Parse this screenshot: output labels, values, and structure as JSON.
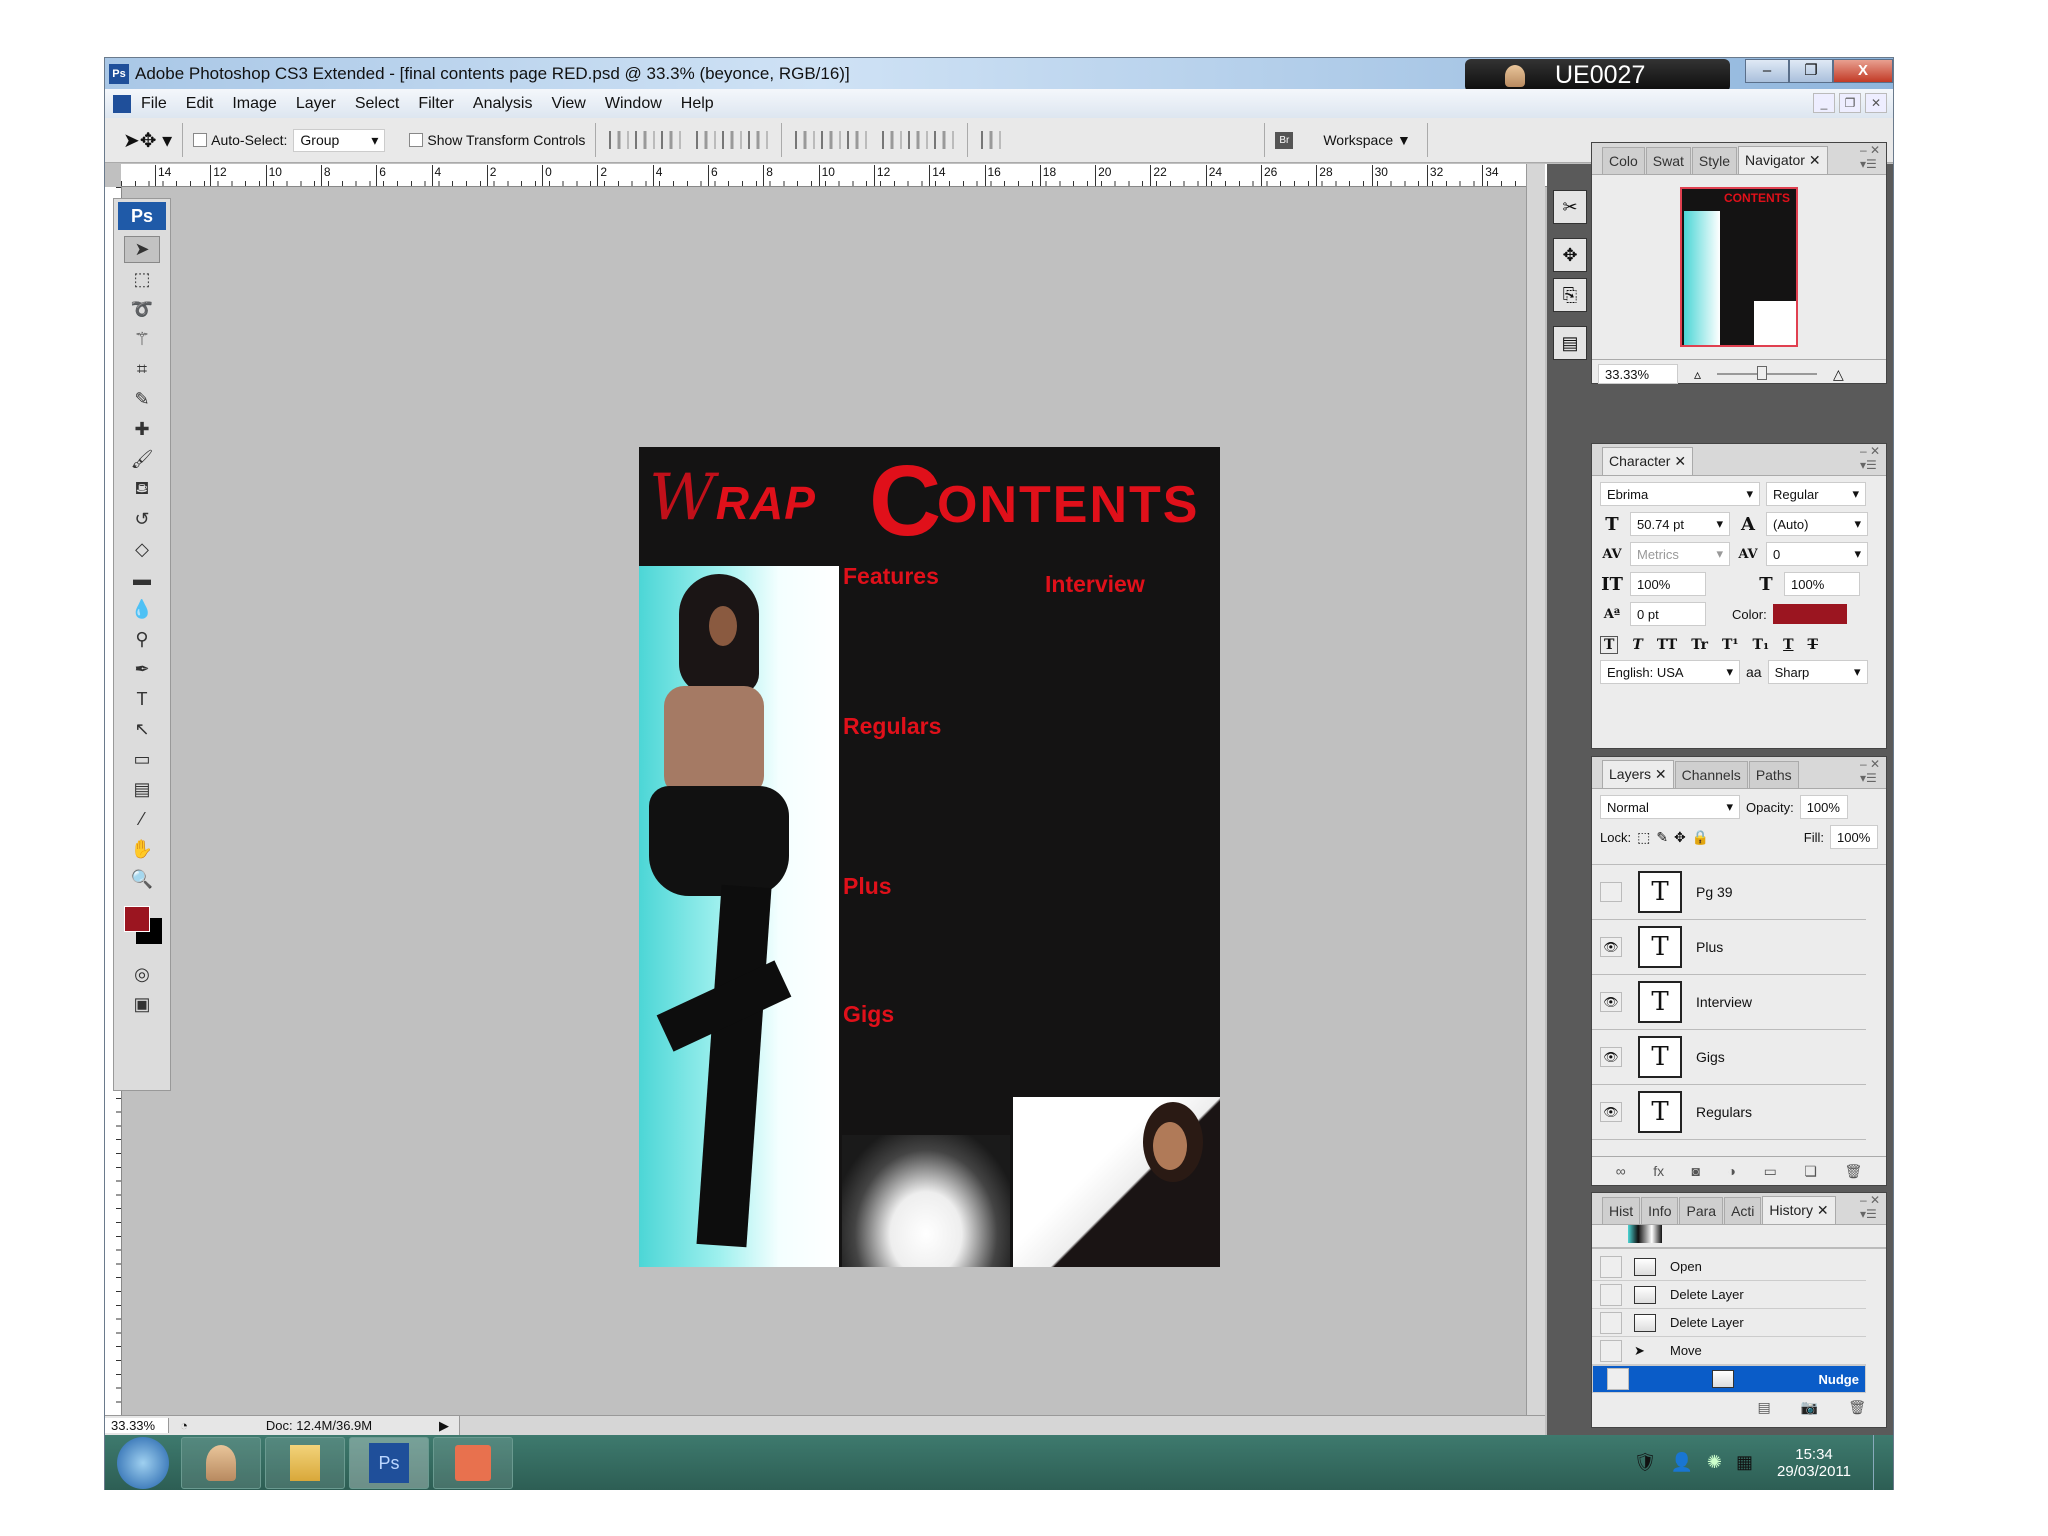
{
  "window": {
    "title": "Adobe Photoshop CS3 Extended - [final contents page RED.psd @ 33.3% (beyonce, RGB/16)]",
    "user": "UE0027",
    "app_badge": "Ps"
  },
  "menu": [
    "File",
    "Edit",
    "Image",
    "Layer",
    "Select",
    "Filter",
    "Analysis",
    "View",
    "Window",
    "Help"
  ],
  "options": {
    "auto_select_label": "Auto-Select:",
    "auto_select_value": "Group",
    "show_transform_label": "Show Transform Controls",
    "workspace_label": "Workspace",
    "bridge_badge": "Br"
  },
  "ruler_ticks": [
    "14",
    "12",
    "10",
    "8",
    "6",
    "4",
    "2",
    "0",
    "2",
    "4",
    "6",
    "8",
    "10",
    "12",
    "14",
    "16",
    "18",
    "20",
    "22",
    "24",
    "26",
    "28",
    "30",
    "32",
    "34"
  ],
  "document": {
    "logo": "WRAP",
    "heading_first": "C",
    "heading_rest": "ONTENTS",
    "sections": {
      "features": "Features",
      "interview": "Interview",
      "regulars": "Regulars",
      "plus": "Plus",
      "gigs": "Gigs"
    }
  },
  "status": {
    "zoom": "33.33%",
    "doc": "Doc: 12.4M/36.9M"
  },
  "navigator": {
    "tabs": [
      "Colo",
      "Swat",
      "Style",
      "Navigator"
    ],
    "zoom": "33.33%",
    "zoom_slider_fraction": 0.25
  },
  "character": {
    "tab": "Character",
    "font": "Ebrima",
    "style": "Regular",
    "size": "50.74 pt",
    "leading": "(Auto)",
    "kerning": "Metrics",
    "tracking": "0",
    "vscale": "100%",
    "hscale": "100%",
    "baseline": "0 pt",
    "color_label": "Color:",
    "color": "#9b1520",
    "language": "English: USA",
    "antialias_icon": "aa",
    "antialias": "Sharp",
    "styles": [
      "T",
      "T",
      "TT",
      "Tr",
      "T¹",
      "T₁",
      "T",
      "T"
    ]
  },
  "layers": {
    "tabs": [
      "Layers",
      "Channels",
      "Paths"
    ],
    "blend": "Normal",
    "opacity_label": "Opacity:",
    "opacity": "100%",
    "lock_label": "Lock:",
    "fill_label": "Fill:",
    "fill": "100%",
    "items": [
      {
        "name": "Pg 39",
        "visible": false
      },
      {
        "name": "Plus",
        "visible": true
      },
      {
        "name": "Interview",
        "visible": true
      },
      {
        "name": "Gigs",
        "visible": true
      },
      {
        "name": "Regulars",
        "visible": true
      }
    ]
  },
  "history": {
    "tabs": [
      "Hist",
      "Info",
      "Para",
      "Acti",
      "History"
    ],
    "items": [
      "Open",
      "Delete Layer",
      "Delete Layer",
      "Move",
      "Nudge"
    ],
    "selected": "Nudge"
  },
  "taskbar": {
    "time": "15:34",
    "date": "29/03/2011",
    "ps_label": "Ps"
  },
  "colors": {
    "accent": "#e0101a",
    "selection": "#0a5cc8",
    "foreground": "#9b1520",
    "background": "#000000"
  }
}
